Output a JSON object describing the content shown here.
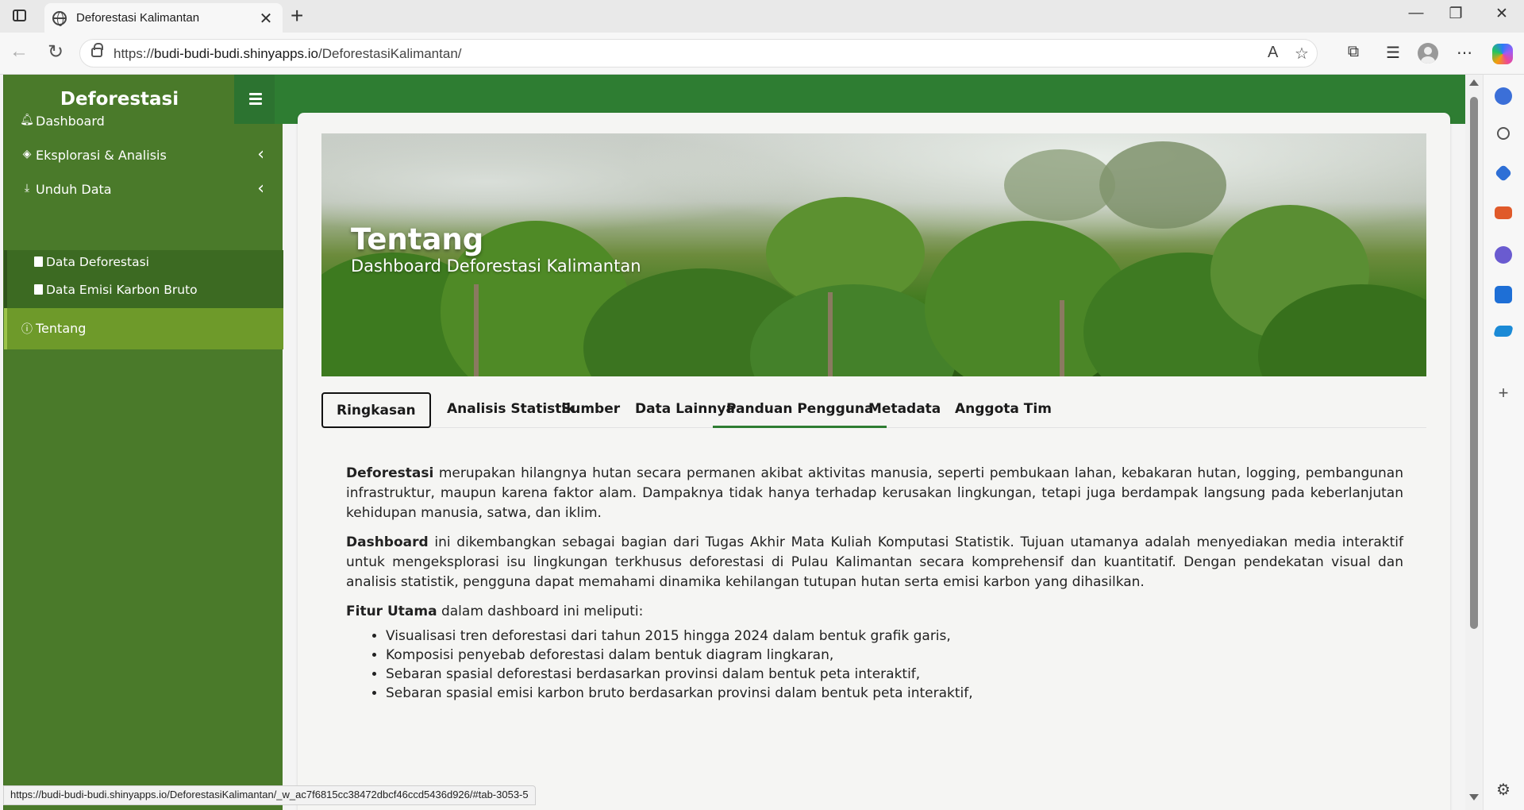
{
  "browser": {
    "tab_title": "Deforestasi Kalimantan",
    "url_prefix": "https://",
    "url_host": "budi-budi-budi.shinyapps.io",
    "url_path": "/DeforestasiKalimantan/",
    "status_url": "https://budi-budi-budi.shinyapps.io/DeforestasiKalimantan/_w_ac7f6815cc38472dbcf46ccd5436d926/#tab-3053-5"
  },
  "sidebar": {
    "brand": "Deforestasi",
    "items": [
      {
        "label": "Dashboard",
        "icon": "bell-icon"
      },
      {
        "label": "Eksplorasi & Analisis",
        "icon": "layers-icon"
      },
      {
        "label": "Unduh Data",
        "icon": "download-icon"
      },
      {
        "label": "Tentang",
        "icon": "info-icon"
      }
    ],
    "subitems": [
      {
        "label": "Data Deforestasi",
        "icon": "file-icon"
      },
      {
        "label": "Data Emisi Karbon Bruto",
        "icon": "file-icon"
      }
    ]
  },
  "hero": {
    "title": "Tentang",
    "subtitle": "Dashboard Deforestasi Kalimantan"
  },
  "tabs": [
    "Ringkasan",
    "Analisis Statistik",
    "Sumber",
    "Data Lainnya",
    "Panduan Pengguna",
    "Metadata",
    "Anggota Tim"
  ],
  "content": {
    "p1_bold": "Deforestasi",
    "p1_text": " merupakan hilangnya hutan secara permanen akibat aktivitas manusia, seperti pembukaan lahan, kebakaran hutan, logging, pembangunan infrastruktur, maupun karena faktor alam. Dampaknya tidak hanya terhadap kerusakan lingkungan, tetapi juga berdampak langsung pada keberlanjutan kehidupan manusia, satwa, dan iklim.",
    "p2_bold": "Dashboard",
    "p2_text": " ini dikembangkan sebagai bagian dari Tugas Akhir Mata Kuliah Komputasi Statistik. Tujuan utamanya adalah menyediakan media interaktif untuk mengeksplorasi isu lingkungan terkhusus deforestasi di Pulau Kalimantan secara komprehensif dan kuantitatif. Dengan pendekatan visual dan analisis statistik, pengguna dapat memahami dinamika kehilangan tutupan hutan serta emisi karbon yang dihasilkan.",
    "p3_bold": "Fitur Utama",
    "p3_text": " dalam dashboard ini meliputi:",
    "features": [
      "Visualisasi tren deforestasi dari tahun 2015 hingga 2024 dalam bentuk grafik garis,",
      "Komposisi penyebab deforestasi dalam bentuk diagram lingkaran,",
      "Sebaran spasial deforestasi berdasarkan provinsi dalam bentuk peta interaktif,",
      "Sebaran spasial emisi karbon bruto berdasarkan provinsi dalam bentuk peta interaktif,"
    ]
  },
  "colors": {
    "sidebar": "#4a7a2a",
    "topnav": "#2e7d32",
    "active_menu": "#6e9a2a"
  }
}
